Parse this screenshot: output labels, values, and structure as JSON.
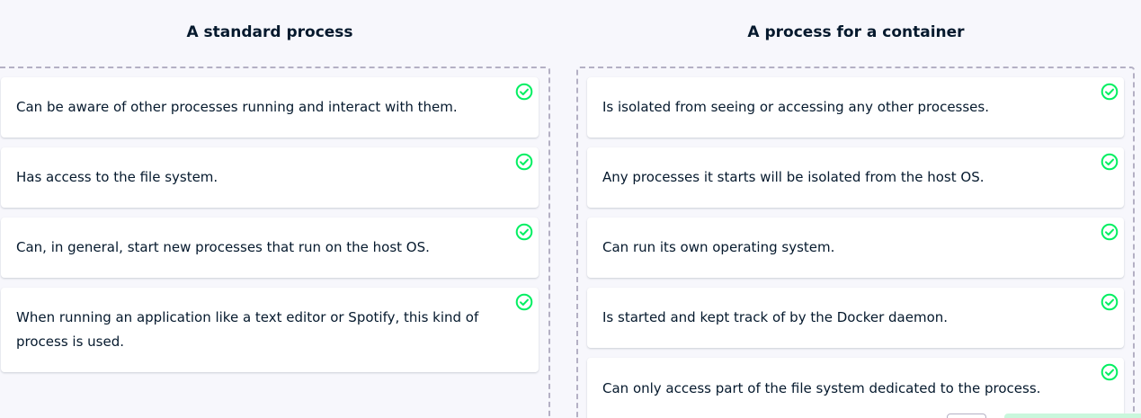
{
  "columns": [
    {
      "title": "A standard process",
      "items": [
        "Can be aware of other processes running and interact with them.",
        "Has access to the file system.",
        "Can, in general, start new processes that run on the host OS.",
        "When running an application like a text editor or Spotify, this kind of process is used."
      ]
    },
    {
      "title": "A process for a container",
      "items": [
        "Is isolated from seeing or accessing any other processes.",
        "Any processes it starts will be isolated from the host OS.",
        "Can run its own operating system.",
        "Is started and kept track of by the Docker daemon.",
        "Can only access part of the file system dedicated to the process."
      ]
    }
  ],
  "item_status_icon": "check-circle-icon",
  "colors": {
    "background": "#f7f7fc",
    "text": "#05192d",
    "correct": "#03ef62",
    "dashed_border": "#b4b0c4"
  }
}
